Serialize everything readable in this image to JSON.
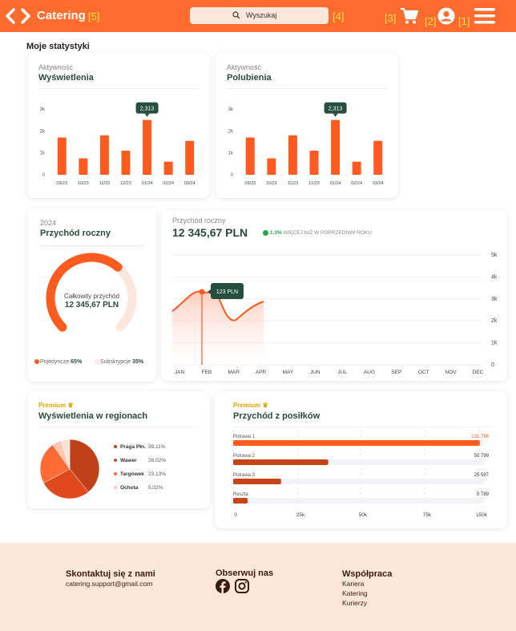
{
  "header": {
    "brand": "Catering",
    "search_placeholder": "Wyszukaj",
    "markers": [
      "[5]",
      "[4]",
      "[3]",
      "[2]",
      "[1]"
    ]
  },
  "page_title": "Moje statystyki",
  "views_card": {
    "kicker": "Aktywność",
    "title": "Wyświetlenia",
    "tooltip": "2,313",
    "y_ticks": [
      "3k",
      "2k",
      "1k",
      "0"
    ],
    "categories": [
      "09/23",
      "10/23",
      "11/23",
      "12/23",
      "01/24",
      "02/24",
      "03/24"
    ],
    "values": [
      1700,
      750,
      1800,
      1100,
      2500,
      600,
      1550
    ]
  },
  "likes_card": {
    "kicker": "Aktywność",
    "title": "Polubienia",
    "tooltip": "2,313",
    "y_ticks": [
      "3k",
      "2k",
      "1k",
      "0"
    ],
    "categories": [
      "09/23",
      "10/23",
      "11/23",
      "12/23",
      "01/24",
      "02/24",
      "03/24"
    ],
    "values": [
      1700,
      750,
      1800,
      1100,
      2500,
      600,
      1550
    ]
  },
  "annual_card": {
    "kicker": "2024",
    "title": "Przychód roczny",
    "center_label": "Całkowity przychód",
    "center_value": "12 345,67 PLN",
    "legend": [
      {
        "label": "Pojedyncze",
        "value": "65%",
        "color": "#ff5a1f"
      },
      {
        "label": "Subskrypcje",
        "value": "35%",
        "color": "#fde6dc"
      }
    ],
    "single_share": 0.65
  },
  "revenue_line": {
    "kicker": "Przychód roczny",
    "value": "12 345,67 PLN",
    "change": "1.3%",
    "change_text": "WIĘCEJ NIŻ W POPRZEDNIM ROKU",
    "tooltip": "123 PLN",
    "y_ticks": [
      "5k",
      "4k",
      "3k",
      "2k",
      "1k",
      "0"
    ],
    "months": [
      "JAN",
      "FEB",
      "MAR",
      "APR",
      "MAY",
      "JUN",
      "JUL",
      "AUG",
      "SEP",
      "OCT",
      "NOV",
      "DEC"
    ]
  },
  "regions_card": {
    "premium": "Premium",
    "title": "Wyświetlenia w regionach",
    "items": [
      {
        "label": "Praga Płn.",
        "value": "39.11%",
        "share": 39.11,
        "color": "#c0401a"
      },
      {
        "label": "Wawer",
        "value": "28.02%",
        "share": 28.02,
        "color": "#e0481e"
      },
      {
        "label": "Targówek",
        "value": "23.13%",
        "share": 23.13,
        "color": "#ff6b35"
      },
      {
        "label": "Ochota",
        "value": "5.02%",
        "share": 5.02,
        "color": "#ffc6b0"
      }
    ]
  },
  "meals_card": {
    "premium": "Premium",
    "title": "Przychód z posiłków",
    "items": [
      {
        "label": "Potrawa 1",
        "value": "131 796",
        "amount": 131796,
        "color": "#ff5a1f",
        "value_color": "#ff5a1f"
      },
      {
        "label": "Potrawa 2",
        "value": "50 799",
        "amount": 50799,
        "color": "#c74419",
        "value_color": "#333"
      },
      {
        "label": "Potrawa 3",
        "value": "25 597",
        "amount": 25597,
        "color": "#c74419",
        "value_color": "#333"
      },
      {
        "label": "Reszta",
        "value": "5 789",
        "amount": 5789,
        "color": "#c74419",
        "value_color": "#333"
      }
    ],
    "x_ticks": [
      "0",
      "25k",
      "50k",
      "75k",
      "150k"
    ]
  },
  "footer": {
    "contact_title": "Skontaktuj się z nami",
    "contact_email": "catering.support@gmail.com",
    "follow_title": "Obserwuj nas",
    "coop_title": "Współpraca",
    "coop_links": [
      "Kariera",
      "Katering",
      "Kurierzy"
    ]
  },
  "colors": {
    "accent": "#ff6b2c",
    "dark_green": "#264f3f",
    "bar": "#ff5a1f"
  }
}
